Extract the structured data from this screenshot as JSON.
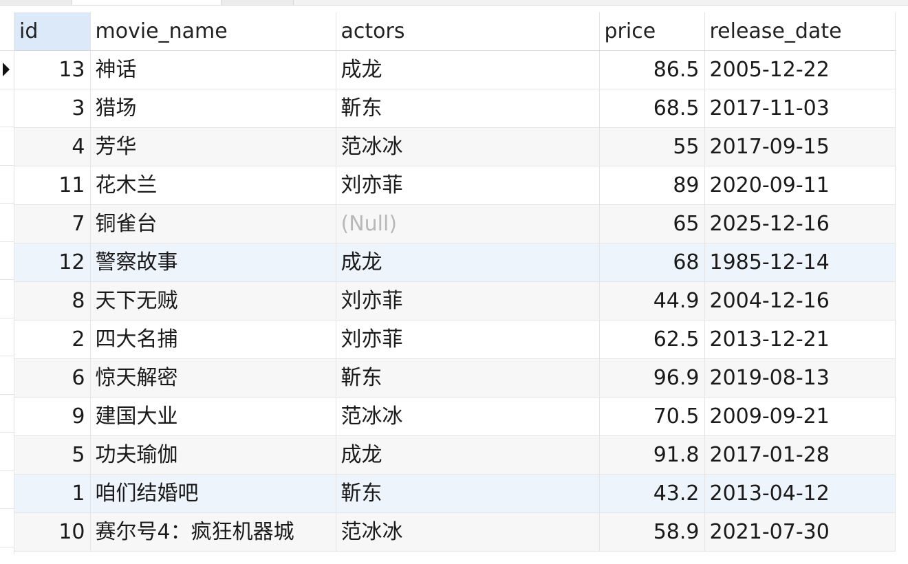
{
  "grid": {
    "columns": [
      "id",
      "movie_name",
      "actors",
      "price",
      "release_date"
    ],
    "selected_column": "id",
    "null_label": "(Null)",
    "rows": [
      {
        "id": "13",
        "movie_name": "神话",
        "actors": "成龙",
        "price": "86.5",
        "release_date": "2005-12-22"
      },
      {
        "id": "3",
        "movie_name": "猎场",
        "actors": "靳东",
        "price": "68.5",
        "release_date": "2017-11-03"
      },
      {
        "id": "4",
        "movie_name": "芳华",
        "actors": "范冰冰",
        "price": "55",
        "release_date": "2017-09-15"
      },
      {
        "id": "11",
        "movie_name": "花木兰",
        "actors": "刘亦菲",
        "price": "89",
        "release_date": "2020-09-11"
      },
      {
        "id": "7",
        "movie_name": "铜雀台",
        "actors": null,
        "price": "65",
        "release_date": "2025-12-16"
      },
      {
        "id": "12",
        "movie_name": "警察故事",
        "actors": "成龙",
        "price": "68",
        "release_date": "1985-12-14"
      },
      {
        "id": "8",
        "movie_name": "天下无贼",
        "actors": "刘亦菲",
        "price": "44.9",
        "release_date": "2004-12-16"
      },
      {
        "id": "2",
        "movie_name": "四大名捕",
        "actors": "刘亦菲",
        "price": "62.5",
        "release_date": "2013-12-21"
      },
      {
        "id": "6",
        "movie_name": "惊天解密",
        "actors": "靳东",
        "price": "96.9",
        "release_date": "2019-08-13"
      },
      {
        "id": "9",
        "movie_name": "建国大业",
        "actors": "范冰冰",
        "price": "70.5",
        "release_date": "2009-09-21"
      },
      {
        "id": "5",
        "movie_name": "功夫瑜伽",
        "actors": "成龙",
        "price": "91.8",
        "release_date": "2017-01-28"
      },
      {
        "id": "1",
        "movie_name": "咱们结婚吧",
        "actors": "靳东",
        "price": "43.2",
        "release_date": "2013-04-12"
      },
      {
        "id": "10",
        "movie_name": "赛尔号4：疯狂机器城",
        "actors": "范冰冰",
        "price": "58.9",
        "release_date": "2021-07-30"
      }
    ],
    "current_row": 0,
    "highlighted_rows": [
      5,
      11
    ]
  },
  "icons": {
    "row_pointer": "current-row-pointer-icon"
  }
}
